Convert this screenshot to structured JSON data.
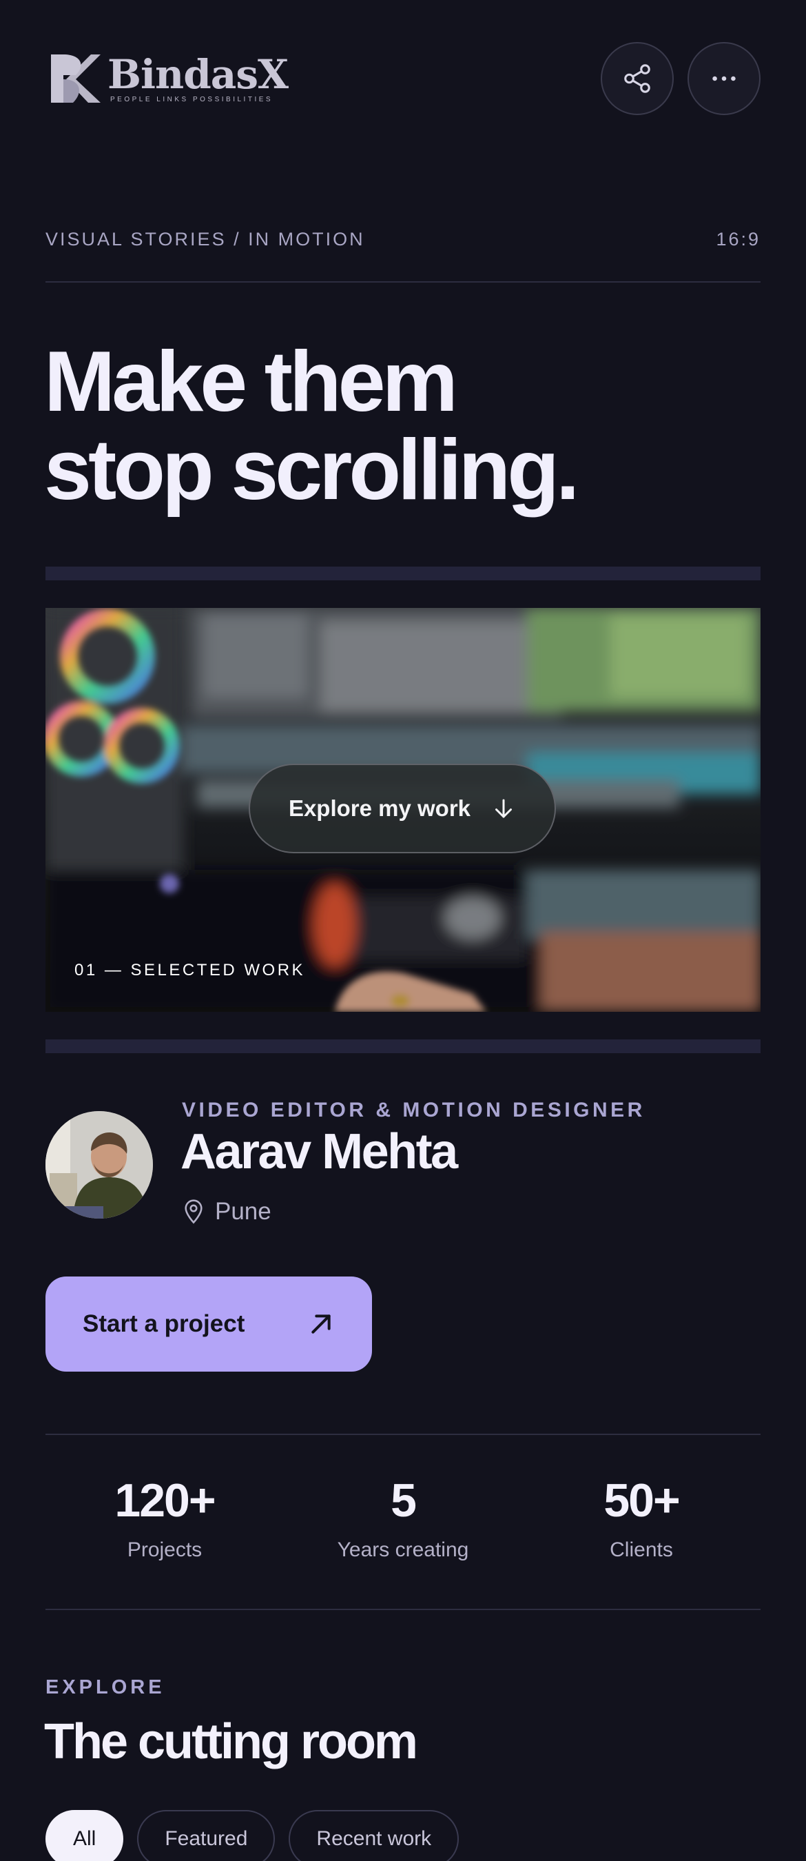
{
  "brand": {
    "name": "BindasX",
    "tagline": "PEOPLE LINKS POSSIBILITIES"
  },
  "header": {
    "share_icon": "share-icon",
    "more_icon": "more-horizontal-icon"
  },
  "meta": {
    "section_label": "VISUAL STORIES / IN MOTION",
    "aspect_ratio": "16:9"
  },
  "headline": {
    "line1": "Make them",
    "line2": "stop scrolling."
  },
  "hero": {
    "button_label": "Explore my work",
    "button_icon": "arrow-down-icon",
    "caption": "01 — SELECTED WORK"
  },
  "profile": {
    "role": "VIDEO EDITOR & MOTION DESIGNER",
    "name": "Aarav Mehta",
    "location": "Pune",
    "location_icon": "map-pin-icon"
  },
  "cta": {
    "label": "Start a project",
    "icon": "arrow-up-right-icon"
  },
  "stats": [
    {
      "value": "120+",
      "label": "Projects"
    },
    {
      "value": "5",
      "label": "Years creating"
    },
    {
      "value": "50+",
      "label": "Clients"
    }
  ],
  "explore": {
    "eyebrow": "EXPLORE",
    "title": "The cutting room",
    "filters": [
      {
        "label": "All",
        "active": true
      },
      {
        "label": "Featured",
        "active": false
      },
      {
        "label": "Recent work",
        "active": false
      }
    ]
  },
  "colors": {
    "background": "#12121d",
    "accent": "#b3a4f7",
    "muted_text": "#aaa6d2"
  }
}
